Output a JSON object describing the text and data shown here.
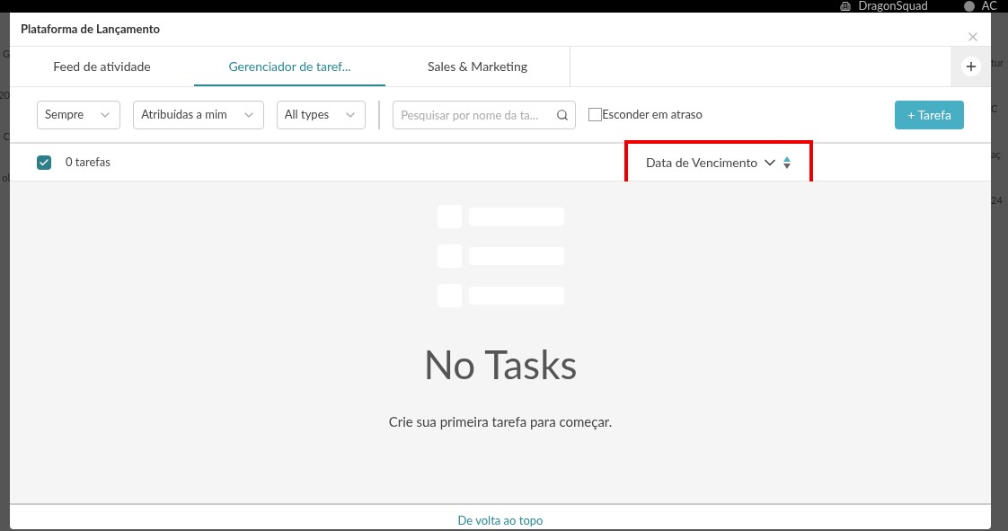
{
  "top_bar": {
    "workspace": "DragonSquad",
    "user": "AC"
  },
  "background": {
    "left_fragments": [
      "G",
      "20",
      "C",
      "ol"
    ],
    "right_fragments": [
      "tur",
      "C",
      "aç",
      "24"
    ]
  },
  "window": {
    "title": "Plataforma de Lançamento"
  },
  "tabs": [
    {
      "label": "Feed de atividade",
      "selected": false
    },
    {
      "label": "Gerenciador de taref...",
      "selected": true
    },
    {
      "label": "Sales & Marketing",
      "selected": false
    }
  ],
  "filters": [
    {
      "label": "Sempre"
    },
    {
      "label": "Atribuídas a mim"
    },
    {
      "label": "All types"
    }
  ],
  "search": {
    "placeholder": "Pesquisar por nome da ta..."
  },
  "hide_overdue": {
    "label": "Esconder em atraso",
    "checked": false
  },
  "add_button": "+ Tarefa",
  "list_header": {
    "select_all_checked": true,
    "count": "0 tarefas",
    "sort": "Data de Vencimento",
    "highlighted": true
  },
  "empty_state": {
    "title": "No Tasks",
    "message": "Crie sua primeira tarefa para começar."
  },
  "footer_link": "De volta ao topo"
}
